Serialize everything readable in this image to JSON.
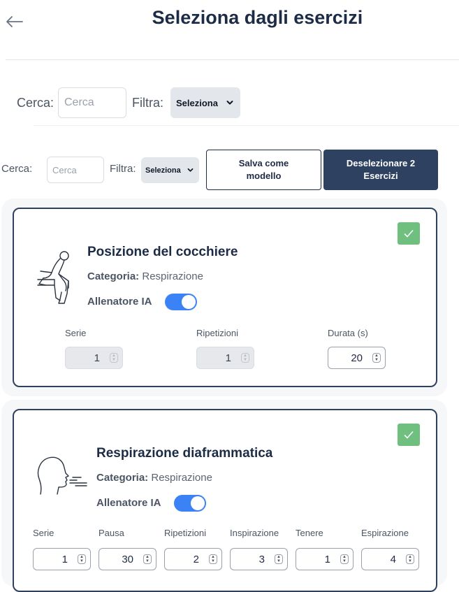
{
  "header": {
    "title": "Seleziona dagli esercizi",
    "back_icon": "arrow-left-icon"
  },
  "filter_row_1": {
    "search_label": "Cerca:",
    "search_placeholder": "Cerca",
    "filter_label": "Filtra:",
    "filter_selected": "Seleziona"
  },
  "filter_row_2": {
    "search_label": "Cerca:",
    "search_placeholder": "Cerca",
    "filter_label": "Filtra:",
    "filter_selected": "Seleziona",
    "save_template_label": "Salva come modello",
    "deselect_label": "Deselezionare 2 Esercizi"
  },
  "exercises": [
    {
      "title": "Posizione del cocchiere",
      "category_label": "Categoria:",
      "category_value": "Respirazione",
      "ai_label": "Allenatore IA",
      "ai_enabled": true,
      "selected": true,
      "icon": "seated-person-icon",
      "fields": [
        {
          "label": "Serie",
          "value": "1",
          "disabled": true
        },
        {
          "label": "Ripetizioni",
          "value": "1",
          "disabled": true
        },
        {
          "label": "Durata (s)",
          "value": "20",
          "disabled": false
        }
      ]
    },
    {
      "title": "Respirazione diaframmatica",
      "category_label": "Categoria:",
      "category_value": "Respirazione",
      "ai_label": "Allenatore IA",
      "ai_enabled": true,
      "selected": true,
      "icon": "head-breathing-icon",
      "fields": [
        {
          "label": "Serie",
          "value": "1",
          "disabled": false
        },
        {
          "label": "Pausa",
          "value": "30",
          "disabled": false
        },
        {
          "label": "Ripetizioni",
          "value": "2",
          "disabled": false
        },
        {
          "label": "Inspirazione",
          "value": "3",
          "disabled": false
        },
        {
          "label": "Tenere",
          "value": "1",
          "disabled": false
        },
        {
          "label": "Espirazione",
          "value": "4",
          "disabled": false
        }
      ]
    }
  ],
  "colors": {
    "accent": "#2f4160",
    "toggle": "#3b82f6",
    "check": "#6fbf7f"
  }
}
